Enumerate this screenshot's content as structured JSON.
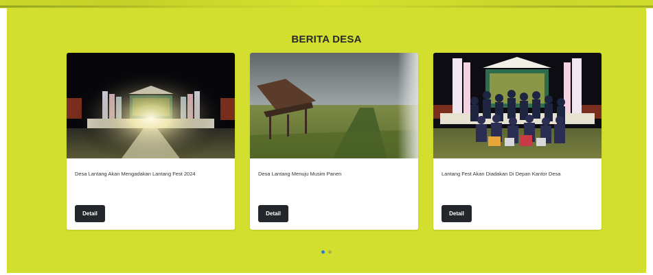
{
  "section": {
    "title": "BERITA DESA",
    "background_color": "#d3df2e"
  },
  "news_cards": [
    {
      "title": "Desa Lantang Akan Mengadakan Lantang Fest 2024",
      "image": "night-stage-with-lights-photo",
      "button_label": "Detail"
    },
    {
      "title": "Desa Lantang Menuju Musim Panen",
      "image": "rice-field-with-hut-photo",
      "button_label": "Detail"
    },
    {
      "title": "Lantang Fest Akan Diadakan Di Depan Kantor Desa",
      "image": "group-photo-on-stage",
      "button_label": "Detail"
    }
  ],
  "carousel": {
    "pages": 2,
    "active_index": 0,
    "active_color": "#2a7bd6"
  }
}
